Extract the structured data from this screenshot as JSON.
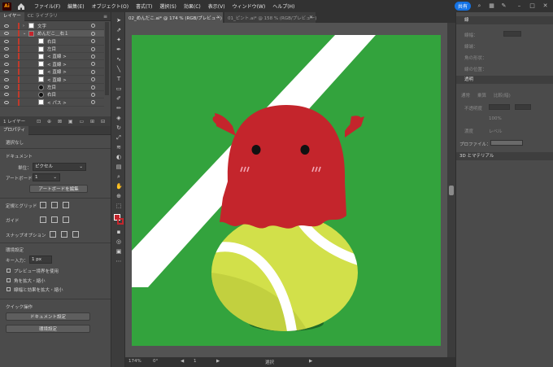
{
  "app": {
    "logo_text": "Ai",
    "menu": [
      "ファイル(F)",
      "編集(E)",
      "オブジェクト(O)",
      "書式(T)",
      "選択(S)",
      "効果(C)",
      "表示(V)",
      "ウィンドウ(W)",
      "ヘルプ(H)"
    ],
    "share_label": "共有"
  },
  "layers_panel": {
    "tabs": [
      "レイヤー",
      "CC ライブラリ"
    ],
    "rows": [
      {
        "name": "文字"
      },
      {
        "name": "めんだこ＿右１"
      },
      {
        "name": "右目"
      },
      {
        "name": "左目"
      },
      {
        "name": "< 直線 >"
      },
      {
        "name": "< 直線 >"
      },
      {
        "name": "< 直線 >"
      },
      {
        "name": "< 直線 >"
      },
      {
        "name": "左目"
      },
      {
        "name": "右目"
      },
      {
        "name": "< パス >"
      }
    ],
    "footer_label": "1 レイヤー"
  },
  "properties_panel": {
    "tab": "プロパティ",
    "selection": "選択なし",
    "document_heading": "ドキュメント",
    "unit_label": "単位：",
    "unit_value": "ピクセル",
    "artboard_label": "アートボード：",
    "artboard_value": "1",
    "edit_artboard_button": "アートボードを編集",
    "rulers_grids_label": "定規とグリッド",
    "guides_label": "ガイド",
    "snap_label": "スナップオプション",
    "prefs_heading": "環境設定",
    "key_increment_label": "キー入力：",
    "key_increment_value": "1 px",
    "opt1": "プレビュー境界を使用",
    "opt2": "角を拡大・縮小",
    "opt3": "線幅と効果を拡大・縮小",
    "quick_actions_heading": "クイック操作",
    "doc_setup_button": "ドキュメント設定",
    "prefs_button": "環境設定"
  },
  "document_tabs": [
    {
      "label": "02_めんだこ.ai* @ 174 % (RGB/プレビュー)",
      "active": true
    },
    {
      "label": "01_ピント.ai* @ 158 % (RGB/プレビュー)",
      "active": false
    }
  ],
  "status_bar": {
    "zoom": "174%",
    "rotation": "0°",
    "artboard": "1",
    "mode": "選択"
  },
  "right_panel": {
    "stroke_tab": "線",
    "stroke_weight_label": "線幅：",
    "label_2": "線端：",
    "label_3": "角の形状：",
    "label_4": "線の位置：",
    "transparency_header": "透明",
    "blend_labels": [
      "通常",
      "乗算",
      "比較(暗)"
    ],
    "opacity_label": "不透明度",
    "opacity_value": "100%",
    "color_labels": [
      "濃度",
      "レベル"
    ],
    "profile_label": "プロファイル：",
    "threed_tab": "3D とマテリアル"
  },
  "colors": {
    "canvas_green": "#33a33d",
    "octopus_red": "#c4252c",
    "ball_yellow": "#d2e04a",
    "ball_shadow": "#b3c23a",
    "court_line": "#ffffff",
    "ui_dark": "#323232",
    "ui_panel": "#4b4b4b",
    "accent_blue": "#1473e6"
  }
}
